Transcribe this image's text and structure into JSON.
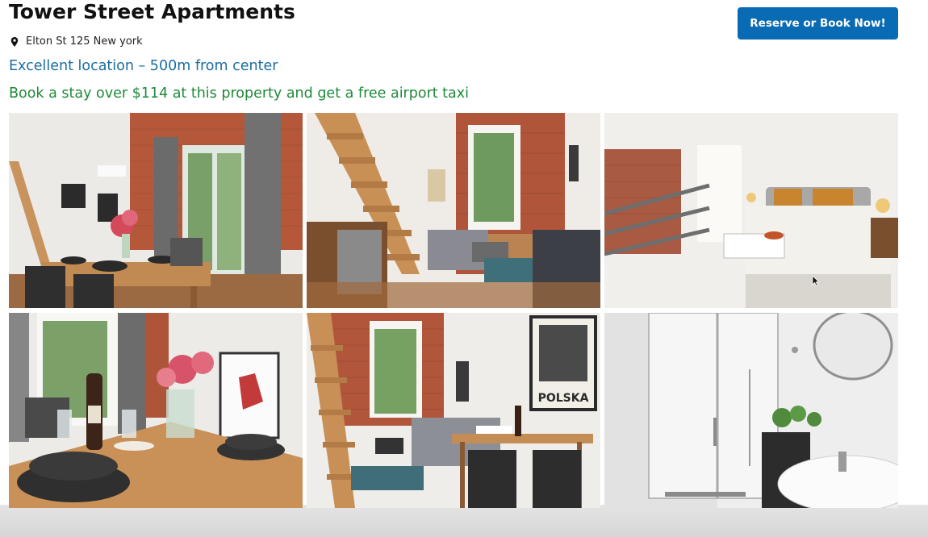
{
  "header": {
    "title": "Tower Street Apartments",
    "address": "Elton St 125 New york",
    "location_note": "Excellent location – 500m from center",
    "promo": "Book a stay over $114 at this property and get a free airport taxi",
    "reserve_label": "Reserve or Book Now!"
  },
  "colors": {
    "accent": "#0a6bb5",
    "location_text": "#1a6ea0",
    "promo_text": "#1f8a3a"
  },
  "gallery": {
    "photos": [
      {
        "subject": "living room with dining table and brick wall",
        "icon": "photo"
      },
      {
        "subject": "loft stairs, kitchenette and sofa",
        "icon": "photo"
      },
      {
        "subject": "bedroom with double bed",
        "icon": "photo"
      },
      {
        "subject": "dining table with flowers and wine",
        "icon": "photo"
      },
      {
        "subject": "living room with Polska poster",
        "icon": "photo"
      },
      {
        "subject": "bathroom with shower and sink",
        "icon": "photo"
      }
    ],
    "poster_text": "POLSKA"
  }
}
